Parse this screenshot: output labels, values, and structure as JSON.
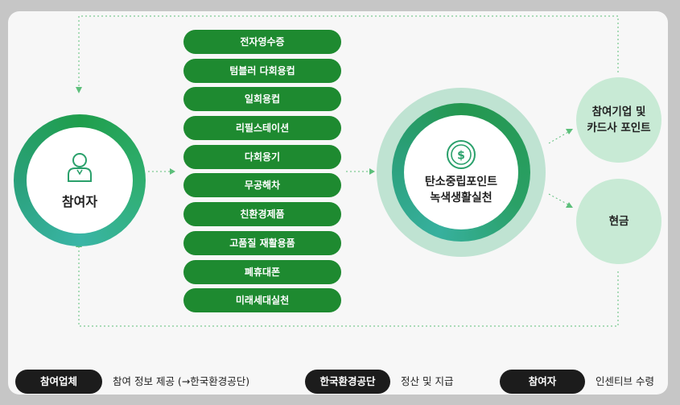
{
  "participant": {
    "label": "참여자",
    "icon": "person-icon"
  },
  "actions": [
    "전자영수증",
    "텀블러 다회용컵",
    "일회용컵",
    "리필스테이션",
    "다회용기",
    "무공해차",
    "친환경제품",
    "고품질 재활용품",
    "폐휴대폰",
    "미래세대실천"
  ],
  "program": {
    "line1": "탄소중립포인트",
    "line2": "녹색생활실천",
    "icon": "dollar-coin-icon"
  },
  "outcomes": {
    "points_line1": "참여기업 및",
    "points_line2": "카드사 포인트",
    "cash": "현금"
  },
  "legend": [
    {
      "badge": "참여업체",
      "text": "참여 정보 제공 (→한국환경공단)"
    },
    {
      "badge": "한국환경공단",
      "text": "정산 및 지급"
    },
    {
      "badge": "참여자",
      "text": "인센티브 수령"
    }
  ],
  "colors": {
    "button_green": "#1e8a30",
    "ring_green": "#24974f",
    "ring_teal": "#37b09e",
    "halo": "#bfe3d2",
    "outcome_fill": "#c8ead5",
    "arrow": "#5cbf7a",
    "legend_badge": "#1c1c1c"
  }
}
